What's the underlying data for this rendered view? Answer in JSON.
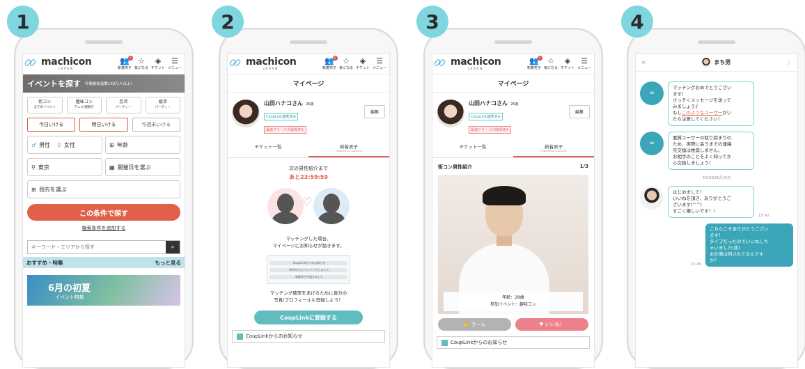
{
  "steps": [
    "1",
    "2",
    "3",
    "4"
  ],
  "header": {
    "logo_text": "machicon",
    "logo_sub": "JAPAN",
    "nav": [
      "新着男子",
      "気になる",
      "チケット",
      "メニュー"
    ],
    "nav_badge": "5"
  },
  "screen1": {
    "banner_title": "イベントを探す",
    "banner_sub": "年間参加者数150万人以上!",
    "categories": [
      {
        "label": "街コン",
        "sub": "全てのイベント"
      },
      {
        "label": "趣味コン",
        "sub": "アニメ/謎解き"
      },
      {
        "label": "恋活",
        "sub": "パーティー"
      },
      {
        "label": "婚活",
        "sub": "パーティー"
      }
    ],
    "days": [
      "今日いける",
      "明日いける",
      "今週末いける"
    ],
    "male": "男性",
    "female": "女性",
    "age": "年齢",
    "location": "東京",
    "date_select": "開催日を選ぶ",
    "purpose": "目的を選ぶ",
    "search_button": "この条件で探す",
    "add_condition": "検索条件を追加する",
    "keyword_placeholder": "キーワード・エリアから探す",
    "featured_title": "おすすめ・特集",
    "featured_more": "もっと見る",
    "featured_banner_line1": "6月の初夏",
    "featured_banner_line2": "イベント特集"
  },
  "mypage": {
    "title": "マイページ",
    "name": "山田ハナコさん",
    "age": "26歳",
    "tag1": "CoupLink連携済み",
    "tag2": "最速フリーパス取得済み",
    "edit": "編集",
    "tab1": "チケット一覧",
    "tab2": "新着男子",
    "tab2_sub": "Powered by CoupLink"
  },
  "screen2": {
    "next_label": "次の男性紹介まで",
    "countdown": "あと23:59:59",
    "match_msg_1": "マッチングした場合、",
    "match_msg_2": "マイページにお知らせが届きます。",
    "thumb_lines": [
      "CoupLinkからのお知らせ",
      "OOOさんとマッチングしました",
      "新着男子が届きました"
    ],
    "rate_msg_1": "マッチング確率をあげるために自分の",
    "rate_msg_2": "写真/プロフィールも登録しよう！",
    "cta": "CoupLinkに登録する",
    "notice": "CoupLinkからのお知らせ"
  },
  "screen3": {
    "intro": "街コン男性紹介",
    "counter": "1/3",
    "age_line": "年齢：28歳",
    "event_line": "参加イベント：趣味コン",
    "skip": "うーん",
    "like": "いいね！",
    "notice": "CoupLinkからのお知らせ"
  },
  "screen4": {
    "back": "<",
    "partner": "まち男",
    "more": "⋮",
    "bot_msg1": [
      "マッチングおめでとうござい",
      "ます！",
      "さっそくメッセージを送って",
      "みましょう♪",
      "もし",
      "このようなユーザー",
      "がい",
      "たら注意してください！"
    ],
    "bot_msg2": [
      "悪質ユーザーの取り締まりの",
      "ため、実際に会うまでの連絡",
      "先交換は推奨しません。",
      "お相手のことをよく知ってか",
      "ら交換しましょう！"
    ],
    "date": "2019年06月25日",
    "partner_msg": [
      "はじめまして！",
      "いいねを頂き、ありがとうご",
      "ざいます(^^)",
      "すごく嬉しいです！！"
    ],
    "partner_time": "15:42",
    "my_msg": [
      "こちらこそありがとうござい",
      "ます！",
      "タイプだったのでいいねしち",
      "ゃいました(笑)",
      "お仕事は何されてるんです",
      "か？"
    ],
    "my_time": "15:45"
  }
}
